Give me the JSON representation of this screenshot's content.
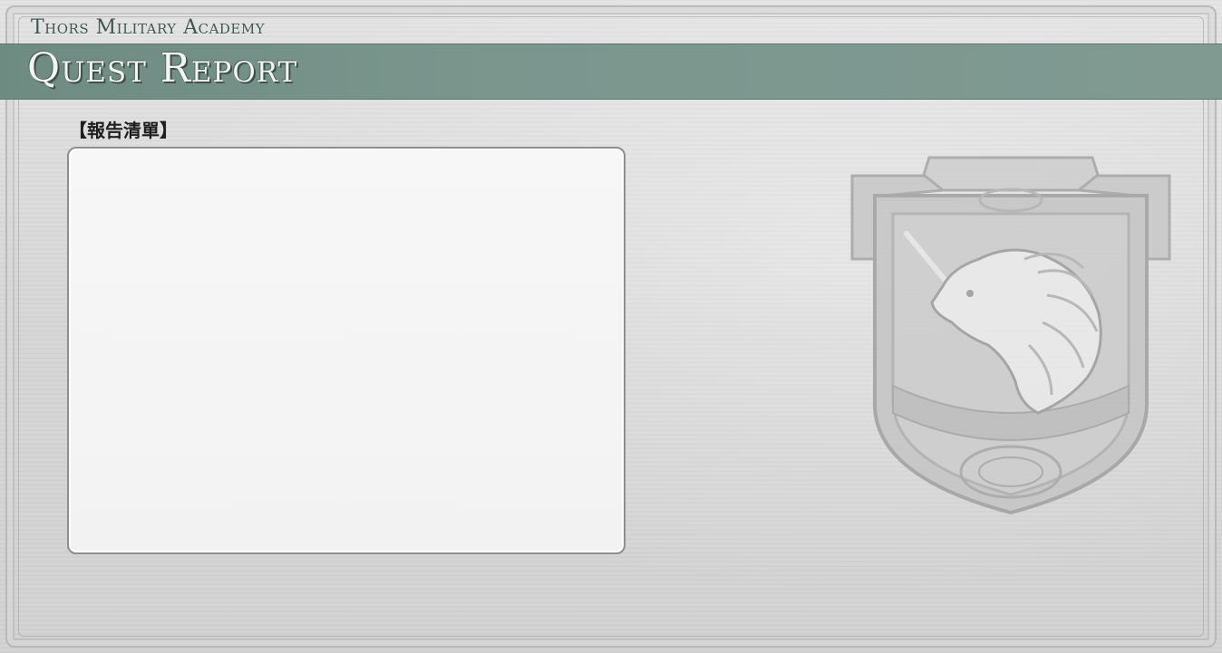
{
  "header": {
    "academy_name": "Thors Military Academy",
    "screen_title": "Quest Report"
  },
  "report": {
    "list_label": "【報告清單】",
    "items": []
  },
  "emblem": {
    "icon": "unicorn-crest-icon"
  },
  "colors": {
    "banner": "#7a968d",
    "academy_text": "#3e5650",
    "title_text": "#f3f3f1"
  }
}
